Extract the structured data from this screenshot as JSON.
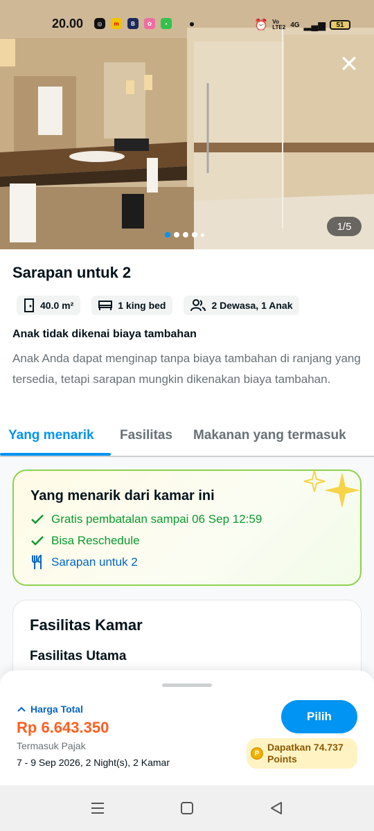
{
  "status_bar": {
    "time": "20.00",
    "battery": "51",
    "network": "4G",
    "volte": "Vo LTE2"
  },
  "gallery": {
    "counter": "1/5",
    "slides_total": 5,
    "active_slide": 1
  },
  "room": {
    "title": "Sarapan untuk 2",
    "chips": [
      {
        "icon": "door-icon",
        "label": "40.0 m²"
      },
      {
        "icon": "bed-icon",
        "label": "1 king bed"
      },
      {
        "icon": "guests-icon",
        "label": "2 Dewasa, 1 Anak"
      }
    ],
    "note_title": "Anak tidak dikenai biaya tambahan",
    "note_body": "Anak Anda dapat menginap tanpa biaya tambahan di ranjang yang tersedia, tetapi sarapan mungkin dikenakan biaya tambahan."
  },
  "tabs": [
    {
      "label": "Yang menarik",
      "active": true
    },
    {
      "label": "Fasilitas",
      "active": false
    },
    {
      "label": "Makanan yang termasuk",
      "active": false
    }
  ],
  "highlights": {
    "title": "Yang menarik dari kamar ini",
    "items": [
      {
        "icon": "check-icon",
        "text": "Gratis pembatalan sampai 06 Sep 12:59",
        "color": "#0a9a2e"
      },
      {
        "icon": "check-icon",
        "text": "Bisa Reschedule",
        "color": "#0a9a2e"
      },
      {
        "icon": "fork-knife-icon",
        "text": "Sarapan untuk 2",
        "color": "#0264c8"
      }
    ]
  },
  "facilities": {
    "title": "Fasilitas Kamar",
    "subtitle": "Fasilitas Utama"
  },
  "booking": {
    "price_label": "Harga Total",
    "price": "Rp 6.643.350",
    "tax_note": "Termasuk Pajak",
    "dates": "7 - 9 Sep 2026, 2 Night(s), 2 Kamar",
    "select_label": "Pilih",
    "points_text": "Dapatkan 74.737 Points",
    "points_coin": "P"
  },
  "colors": {
    "accent": "#0194f3",
    "price": "#ff5e1f",
    "success": "#0a9a2e",
    "link": "#0264c8"
  }
}
